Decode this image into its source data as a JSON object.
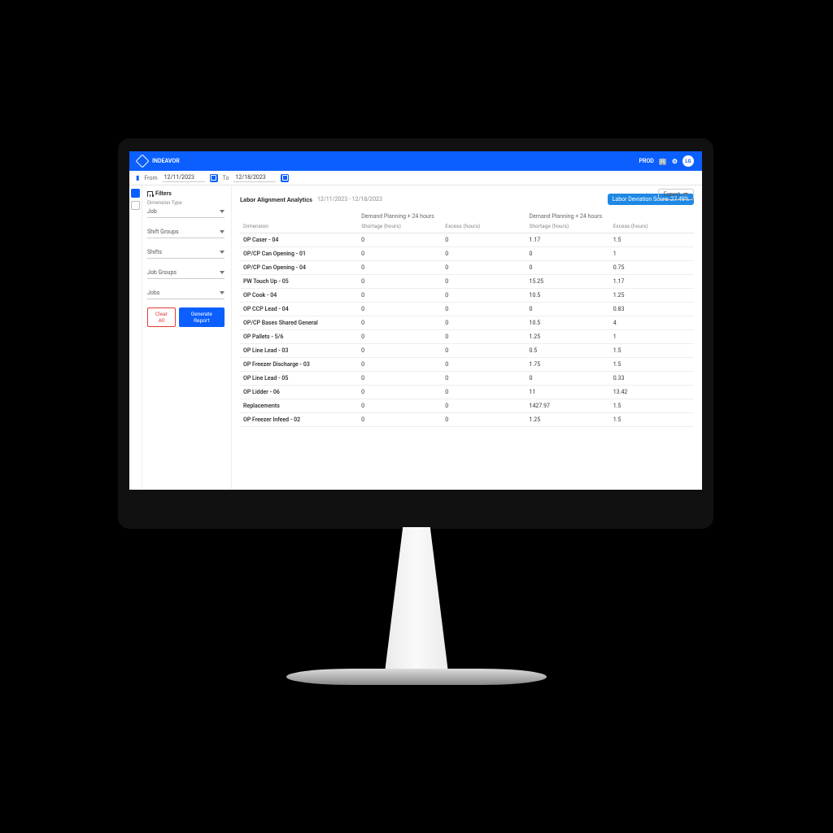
{
  "brand": "INDEAVOR",
  "tenant": "PROD",
  "avatar": "LG",
  "datebar": {
    "from_label": "From",
    "from": "12/11/2023",
    "to_label": "To",
    "to": "12/18/2023"
  },
  "sidebar": {
    "title": "Filters",
    "dim_label": "Dimension Type",
    "dim_value": "Job",
    "selects": [
      {
        "label": "Shift Groups"
      },
      {
        "label": "Shifts"
      },
      {
        "label": "Job Groups"
      },
      {
        "label": "Jobs"
      }
    ],
    "clear": "Clear All",
    "generate": "Generate Report"
  },
  "main": {
    "export": "Export",
    "title": "Labor Alignment Analytics",
    "range": "12/11/2023 - 12/18/2023",
    "lds_label": "Labor Deviation Score:",
    "lds_value": "27.49%",
    "group_a": "Demand Planning + 24 hours",
    "group_b": "Demand Planning + 24 hours",
    "col_dim": "Dimension",
    "col_short": "Shortage (hours)",
    "col_excess": "Excess (hours)"
  },
  "rows": [
    {
      "dim": "OP Caser - 04",
      "a_s": "0",
      "a_e": "0",
      "b_s": "1.17",
      "b_e": "1.5"
    },
    {
      "dim": "OP/CP Can Opening - 01",
      "a_s": "0",
      "a_e": "0",
      "b_s": "0",
      "b_e": "1"
    },
    {
      "dim": "OP/CP Can Opening - 04",
      "a_s": "0",
      "a_e": "0",
      "b_s": "0",
      "b_e": "0.75"
    },
    {
      "dim": "PW Touch Up - 05",
      "a_s": "0",
      "a_e": "0",
      "b_s": "15.25",
      "b_e": "1.17"
    },
    {
      "dim": "OP Cook - 04",
      "a_s": "0",
      "a_e": "0",
      "b_s": "10.5",
      "b_e": "1.25"
    },
    {
      "dim": "OP CCP Lead - 04",
      "a_s": "0",
      "a_e": "0",
      "b_s": "0",
      "b_e": "0.83"
    },
    {
      "dim": "OP/CP Bases Shared General",
      "a_s": "0",
      "a_e": "0",
      "b_s": "10.5",
      "b_e": "4"
    },
    {
      "dim": "OP Pallets - 5/6",
      "a_s": "0",
      "a_e": "0",
      "b_s": "1.25",
      "b_e": "1"
    },
    {
      "dim": "OP Line Lead - 03",
      "a_s": "0",
      "a_e": "0",
      "b_s": "0.5",
      "b_e": "1.5"
    },
    {
      "dim": "OP Freezer Discharge - 03",
      "a_s": "0",
      "a_e": "0",
      "b_s": "1.75",
      "b_e": "1.5"
    },
    {
      "dim": "OP Line Lead - 05",
      "a_s": "0",
      "a_e": "0",
      "b_s": "0",
      "b_e": "0.33"
    },
    {
      "dim": "OP Lidder - 06",
      "a_s": "0",
      "a_e": "0",
      "b_s": "11",
      "b_e": "13.42"
    },
    {
      "dim": "Replacements",
      "a_s": "0",
      "a_e": "0",
      "b_s": "1427.97",
      "b_e": "1.5"
    },
    {
      "dim": "OP Freezer Infeed - 02",
      "a_s": "0",
      "a_e": "0",
      "b_s": "1.25",
      "b_e": "1.5"
    }
  ]
}
